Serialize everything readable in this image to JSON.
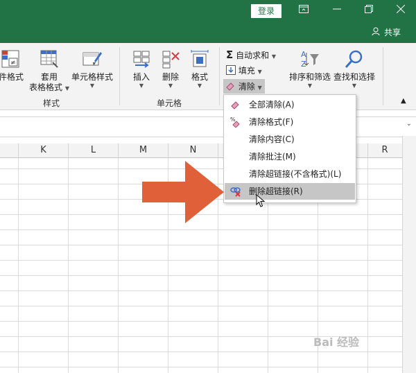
{
  "titlebar": {
    "login_label": "登录",
    "share_label": "共享",
    "icons": [
      "restore-ribbon-icon",
      "minimize-icon",
      "restore-icon",
      "close-icon"
    ]
  },
  "ribbon": {
    "styles_group": {
      "label": "样式",
      "cond_format": "件格式",
      "table_format_1": "套用",
      "table_format_2": "表格格式",
      "cell_style": "单元格样式"
    },
    "cells_group": {
      "label": "单元格",
      "insert": "插入",
      "delete": "删除",
      "format": "格式"
    },
    "editing_group": {
      "autosum": "自动求和",
      "fill": "填充",
      "clear": "清除",
      "sort_filter": "排序和筛选",
      "find_select": "查找和选择"
    }
  },
  "columns": [
    "K",
    "L",
    "M",
    "N",
    "R"
  ],
  "clear_menu": {
    "items": [
      {
        "label": "全部清除(A)"
      },
      {
        "label": "清除格式(F)"
      },
      {
        "label": "清除内容(C)"
      },
      {
        "label": "清除批注(M)"
      },
      {
        "label": "清除超链接(不含格式)(L)"
      },
      {
        "label": "删除超链接(R)"
      }
    ]
  },
  "colors": {
    "accent": "#217346",
    "arrow": "#e0603a"
  },
  "watermark": "Bai 经验"
}
